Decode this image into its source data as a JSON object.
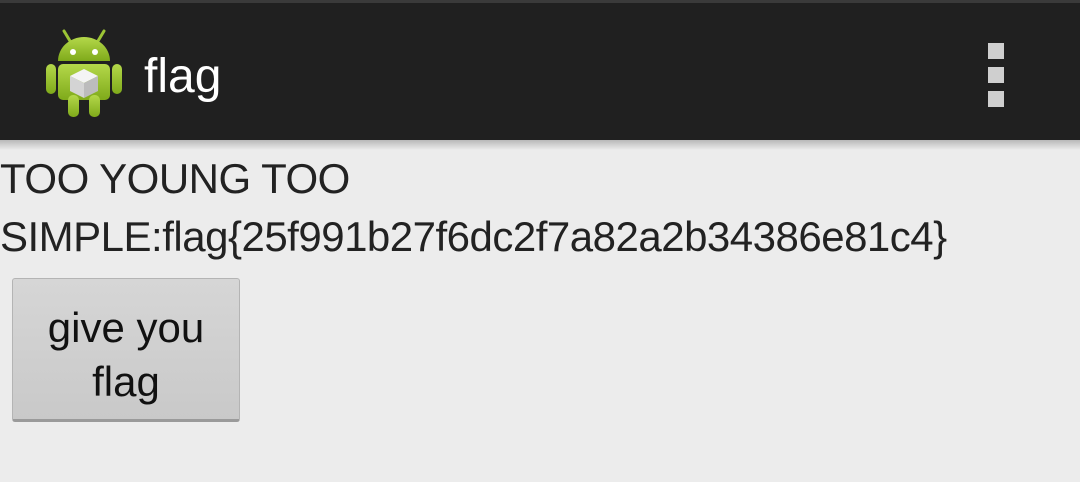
{
  "action_bar": {
    "title": "flag",
    "app_icon": "android-robot-icon",
    "overflow_icon": "overflow-menu-icon",
    "background_color": "#202020"
  },
  "content": {
    "message": "TOO YOUNG TOO SIMPLE:flag{25f991b27f6dc2f7a82a2b34386e81c4}",
    "button_label": "give you flag"
  }
}
